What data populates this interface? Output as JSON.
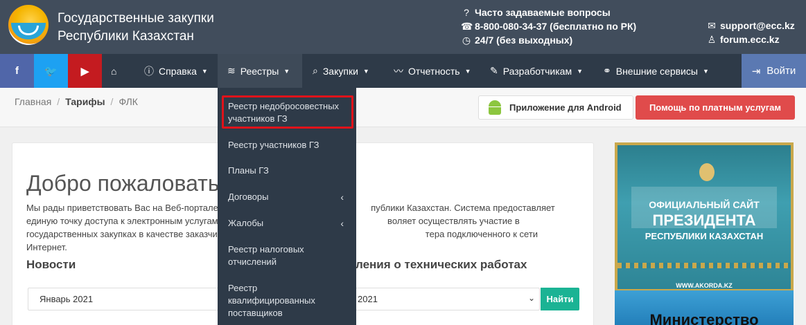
{
  "header": {
    "title_line1": "Государственные закупки",
    "title_line2": "Республики Казахстан",
    "faq": "Часто задаваемые вопросы",
    "phone": "8-800-080-34-37 (бесплатно по РК)",
    "hours": "24/7 (без выходных)",
    "email": "support@ecc.kz",
    "forum": "forum.ecc.kz"
  },
  "nav": {
    "help": "Справка",
    "registries": "Реестры",
    "purchases": "Закупки",
    "reports": "Отчетность",
    "developers": "Разработчикам",
    "external": "Внешние сервисы",
    "login": "Войти"
  },
  "breadcrumb": {
    "home": "Главная",
    "tariffs": "Тарифы",
    "flk": "ФЛК"
  },
  "buttons": {
    "android": "Приложение для Android",
    "paid_help": "Помощь по платным услугам",
    "find": "Найти"
  },
  "main": {
    "welcome": "Добро пожаловать!",
    "intro": "Мы рады приветствовать Вас на Веб-портале                                                             публики Казахстан. Система предоставляет единую точку доступа к электронным услугам в сфер                                                       воляет осуществлять участие в государственных закупках в качестве заказчика, организатора                                                       тера подключенного к сети Интернет.",
    "news_title": "Новости",
    "tech_title": "ления о технических работах",
    "news_select": "Январь 2021",
    "tech_select": "2021"
  },
  "dropdown": {
    "items": [
      "Реестр недобросовестных участников ГЗ",
      "Реестр участников ГЗ",
      "Планы ГЗ",
      "Договоры",
      "Жалобы",
      "Реестр налоговых отчислений",
      "Реестр квалифицированных поставщиков"
    ]
  },
  "banners": {
    "president_line1": "ОФИЦИАЛЬНЫЙ САЙТ",
    "president_line2": "ПРЕЗИДЕНТА",
    "president_line3": "РЕСПУБЛИКИ КАЗАХСТАН",
    "president_url": "WWW.AKORDA.KZ",
    "ministry": "Министерство"
  },
  "colors": {
    "header_bg": "#414d5c",
    "nav_bg": "#2e3a48",
    "facebook": "#5066a9",
    "twitter": "#1da1f2",
    "youtube": "#c41b20",
    "login_bg": "#5b79b2",
    "help_btn": "#e04b4b",
    "find_btn": "#1bb394",
    "highlight": "#e0121a"
  }
}
